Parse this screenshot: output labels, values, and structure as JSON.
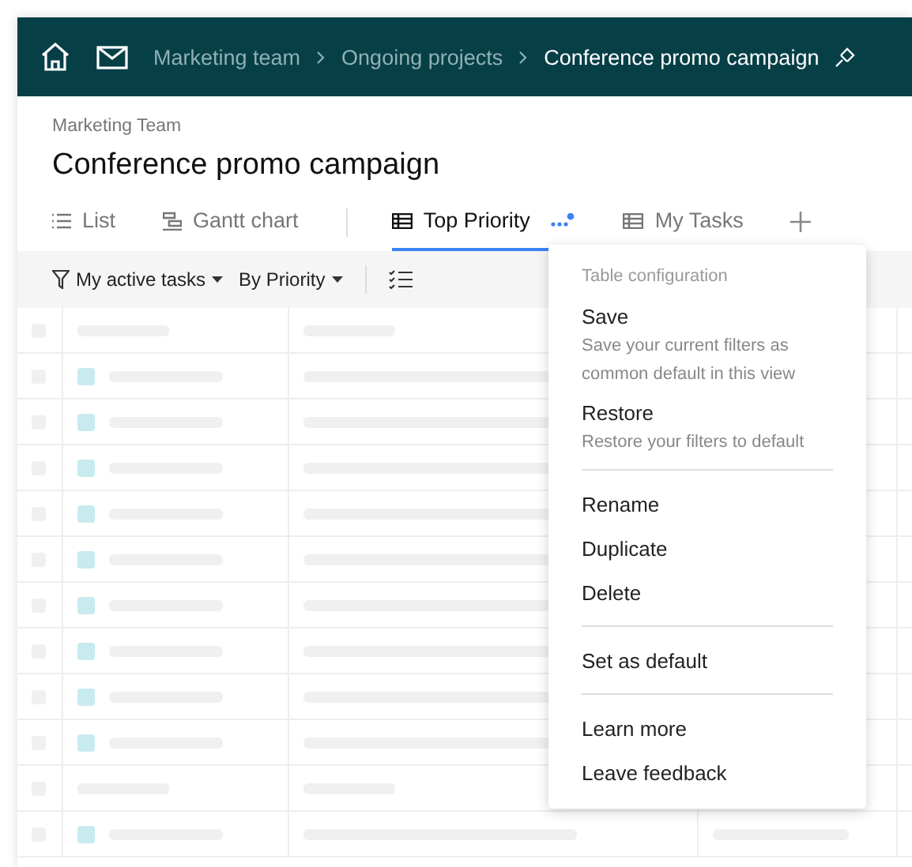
{
  "header": {
    "breadcrumbs": [
      {
        "label": "Marketing team",
        "current": false
      },
      {
        "label": "Ongoing projects",
        "current": false
      },
      {
        "label": "Conference promo campaign",
        "current": true
      }
    ]
  },
  "project": {
    "team": "Marketing Team",
    "title": "Conference promo campaign"
  },
  "tabs": [
    {
      "label": "List",
      "kind": "list",
      "selected": false
    },
    {
      "label": "Gantt chart",
      "kind": "gantt",
      "selected": false
    },
    {
      "label": "Top Priority",
      "kind": "table",
      "selected": true
    },
    {
      "label": "My Tasks",
      "kind": "table",
      "selected": false
    }
  ],
  "toolbar": {
    "filter": "My active tasks",
    "sort": "By Priority"
  },
  "table": {
    "rows": [
      {
        "kind": "group"
      },
      {
        "kind": "task"
      },
      {
        "kind": "task"
      },
      {
        "kind": "task"
      },
      {
        "kind": "task"
      },
      {
        "kind": "task"
      },
      {
        "kind": "task"
      },
      {
        "kind": "task"
      },
      {
        "kind": "task"
      },
      {
        "kind": "task"
      },
      {
        "kind": "group"
      },
      {
        "kind": "task"
      }
    ]
  },
  "menu": {
    "title": "Table configuration",
    "sections": [
      [
        {
          "label": "Save",
          "description": "Save your current filters as common default in this view"
        },
        {
          "label": "Restore",
          "description": "Restore your filters to default"
        }
      ],
      [
        {
          "label": "Rename"
        },
        {
          "label": "Duplicate"
        },
        {
          "label": "Delete"
        }
      ],
      [
        {
          "label": "Set as default"
        }
      ],
      [
        {
          "label": "Learn more"
        },
        {
          "label": "Leave feedback"
        }
      ]
    ]
  }
}
